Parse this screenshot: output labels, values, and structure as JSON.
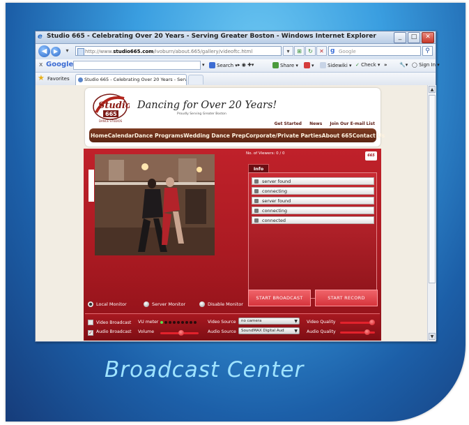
{
  "slide": {
    "caption": "Broadcast Center"
  },
  "window": {
    "title": "Studio 665 - Celebrating Over 20 Years - Serving Greater Boston - Windows Internet Explorer",
    "controls": {
      "minimize": "_",
      "maximize": "□",
      "close": "✕"
    }
  },
  "addressbar": {
    "url_prefix": "http://www.",
    "url_domain": "studio665.com",
    "url_path": "/ivoburn/about.665/gallery/videoftc.html",
    "search_placeholder": "Google"
  },
  "google_toolbar": {
    "logo": "Google",
    "search_label": "Search",
    "share_label": "Share",
    "sidewiki_label": "Sidewiki",
    "check_label": "Check",
    "more_label": "»",
    "signin_label": "Sign In"
  },
  "favorites": {
    "label": "Favorites",
    "tab_title": "Studio 665 - Celebrating Over 20 Years - Serving Gre..."
  },
  "site": {
    "logo_text": "Studio 665",
    "slogan": "Dancing for Over 20 Years!",
    "subslogan": "Proudly Serving Greater Boston",
    "top_links": [
      "Get Started",
      "News",
      "Join Our E-mail List"
    ],
    "menu": [
      "Home",
      "Calendar",
      "Dance Programs",
      "Wedding Dance Prep",
      "Corporate/Private Parties",
      "About 665",
      "Contact Us"
    ]
  },
  "broadcast": {
    "viewers_label": "No. of Viewers: 0 / 0",
    "info_tab": "Info",
    "log": [
      "server found",
      "connecting",
      "server found",
      "connecting",
      "connected"
    ],
    "start_broadcast": "START BROADCAST",
    "start_record": "START RECORD",
    "monitors": [
      "Local Monitor",
      "Server Monitor",
      "Disable Monitor"
    ],
    "monitor_selected": "Local Monitor",
    "video_broadcast_label": "Video Broadcast",
    "audio_broadcast_label": "Audio Broadcast",
    "audio_broadcast_checked": true,
    "vu_label": "VU meter",
    "volume_label": "Volume",
    "video_source_label": "Video Source",
    "video_source_value": "no camera",
    "audio_source_label": "Audio Source",
    "audio_source_value": "SoundMAX Digital Aud",
    "video_quality_label": "Video Quality",
    "audio_quality_label": "Audio Quality",
    "volume_level": 0.55,
    "video_quality_level": 0.92,
    "audio_quality_level": 0.78,
    "vu_leds_on": 1,
    "vu_leds_total": 9
  },
  "colors": {
    "accent_red": "#c0212a",
    "menu_brown": "#6b2d18",
    "slide_blue": "#3a9ee0"
  }
}
